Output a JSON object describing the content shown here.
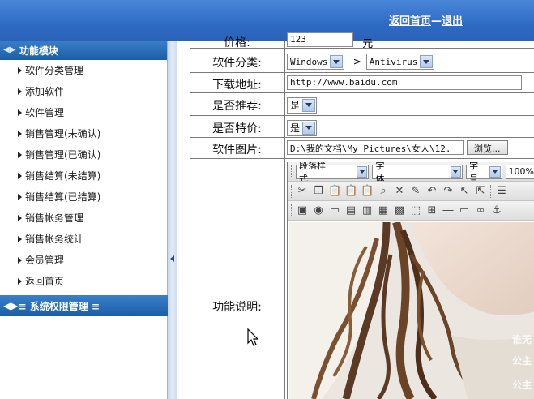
{
  "header": {
    "home_link": "返回首页",
    "separator": "—",
    "logout_link": "退出"
  },
  "sidebar": {
    "module1_title": "功能模块",
    "items": [
      {
        "label": "软件分类管理"
      },
      {
        "label": "添加软件"
      },
      {
        "label": "软件管理"
      },
      {
        "label": "销售管理(未确认)"
      },
      {
        "label": "销售管理(已确认)"
      },
      {
        "label": "销售结算(未结算)"
      },
      {
        "label": "销售结算(已结算)"
      },
      {
        "label": "销售帐务管理"
      },
      {
        "label": "销售帐务统计"
      },
      {
        "label": "会员管理"
      },
      {
        "label": "返回首页"
      }
    ],
    "module2_title": "≡ 系统权限管理 ≡"
  },
  "form": {
    "price_label": "价格:",
    "price_value": "123",
    "price_unit": "元",
    "category_label": "软件分类:",
    "category_main": "Windows",
    "category_arrow": "->",
    "category_sub": "Antivirus",
    "download_label": "下载地址:",
    "download_value": "http://www.baidu.com",
    "recommend_label": "是否推荐:",
    "recommend_value": "是",
    "special_label": "是否特价:",
    "special_value": "是",
    "image_label": "软件图片:",
    "image_value": "D:\\我的文档\\My Pictures\\女人\\12.",
    "browse_button": "浏览...",
    "description_label": "功能说明:"
  },
  "editor": {
    "paragraph_style": "段落样式",
    "font": "字体",
    "font_size": "字号",
    "zoom": "100%",
    "watermark1": "谁无",
    "watermark2": "公主",
    "watermark3": "公主"
  },
  "colors": {
    "header_blue": "#2e6bc4",
    "module_blue": "#1b5ea8"
  }
}
